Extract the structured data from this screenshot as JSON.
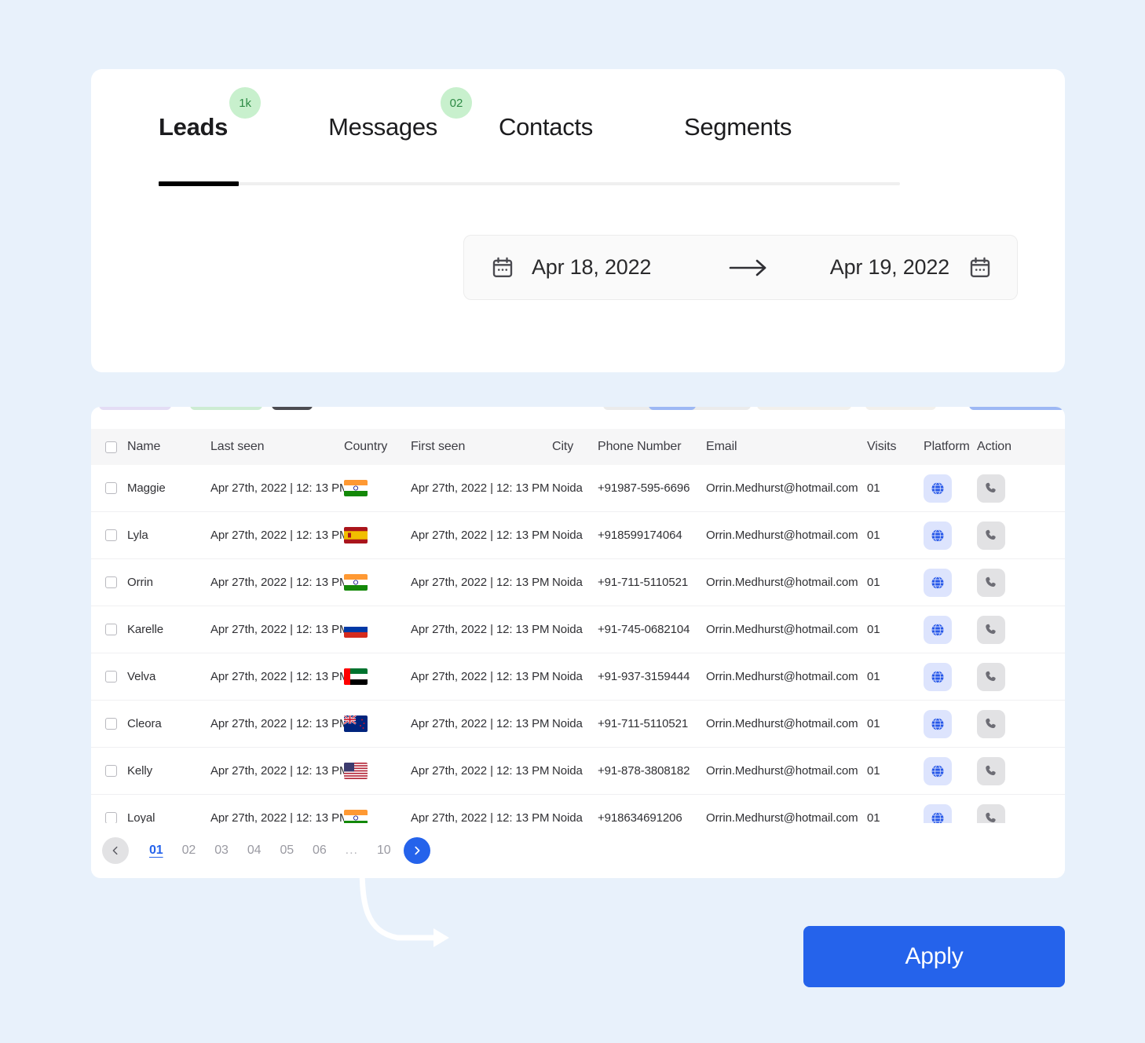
{
  "tabs": [
    {
      "label": "Leads",
      "badge": "1k",
      "active": true
    },
    {
      "label": "Messages",
      "badge": "02",
      "active": false
    },
    {
      "label": "Contacts",
      "badge": "",
      "active": false
    },
    {
      "label": "Segments",
      "badge": "",
      "active": false
    }
  ],
  "date_range": {
    "start": "Apr 18, 2022",
    "end": "Apr 19, 2022",
    "start_icon": "calendar-icon",
    "end_icon": "calendar-icon",
    "separator_icon": "arrow-right-icon"
  },
  "table": {
    "columns": [
      "Name",
      "Last seen",
      "Country",
      "First seen",
      "City",
      "Phone Number",
      "Email",
      "Visits",
      "Platform",
      "Action"
    ],
    "platform_icon": "globe-icon",
    "action_icon": "phone-icon",
    "rows": [
      {
        "name": "Maggie",
        "last_seen": "Apr 27th, 2022 | 12: 13 PM",
        "country": "in",
        "country_label": "India",
        "first_seen": "Apr 27th, 2022 | 12: 13 PM",
        "city": "Noida",
        "phone": "+91987-595-6696",
        "email": "Orrin.Medhurst@hotmail.com",
        "visits": "01"
      },
      {
        "name": "Lyla",
        "last_seen": "Apr 27th, 2022 | 12: 13 PM",
        "country": "es",
        "country_label": "Spain",
        "first_seen": "Apr 27th, 2022 | 12: 13 PM",
        "city": "Noida",
        "phone": "+918599174064",
        "email": "Orrin.Medhurst@hotmail.com",
        "visits": "01"
      },
      {
        "name": "Orrin",
        "last_seen": "Apr 27th, 2022 | 12: 13 PM",
        "country": "in",
        "country_label": "India",
        "first_seen": "Apr 27th, 2022 | 12: 13 PM",
        "city": "Noida",
        "phone": "+91-711-5110521",
        "email": "Orrin.Medhurst@hotmail.com",
        "visits": "01"
      },
      {
        "name": "Karelle",
        "last_seen": "Apr 27th, 2022 | 12: 13 PM",
        "country": "ru",
        "country_label": "Russia",
        "first_seen": "Apr 27th, 2022 | 12: 13 PM",
        "city": "Noida",
        "phone": "+91-745-0682104",
        "email": "Orrin.Medhurst@hotmail.com",
        "visits": "01"
      },
      {
        "name": "Velva",
        "last_seen": "Apr 27th, 2022 | 12: 13 PM",
        "country": "ae",
        "country_label": "UAE",
        "first_seen": "Apr 27th, 2022 | 12: 13 PM",
        "city": "Noida",
        "phone": "+91-937-3159444",
        "email": "Orrin.Medhurst@hotmail.com",
        "visits": "01"
      },
      {
        "name": "Cleora",
        "last_seen": "Apr 27th, 2022 | 12: 13 PM",
        "country": "nz",
        "country_label": "New Zealand",
        "first_seen": "Apr 27th, 2022 | 12: 13 PM",
        "city": "Noida",
        "phone": "+91-711-5110521",
        "email": "Orrin.Medhurst@hotmail.com",
        "visits": "01"
      },
      {
        "name": "Kelly",
        "last_seen": "Apr 27th, 2022 | 12: 13 PM",
        "country": "us",
        "country_label": "USA",
        "first_seen": "Apr 27th, 2022 | 12: 13 PM",
        "city": "Noida",
        "phone": "+91-878-3808182",
        "email": "Orrin.Medhurst@hotmail.com",
        "visits": "01"
      },
      {
        "name": "Loyal",
        "last_seen": "Apr 27th, 2022 | 12: 13 PM",
        "country": "in",
        "country_label": "India",
        "first_seen": "Apr 27th, 2022 | 12: 13 PM",
        "city": "Noida",
        "phone": "+918634691206",
        "email": "Orrin.Medhurst@hotmail.com",
        "visits": "01"
      }
    ]
  },
  "pagination": {
    "prev_icon": "chevron-left-icon",
    "next_icon": "chevron-right-icon",
    "pages": [
      "01",
      "02",
      "03",
      "04",
      "05",
      "06",
      "...",
      "10"
    ],
    "current": "01"
  },
  "apply": {
    "label": "Apply"
  },
  "colors": {
    "background": "#e8f1fb",
    "card": "#ffffff",
    "accent_blue": "#2563eb",
    "badge_green_bg": "#c8f0cd",
    "badge_green_text": "#2e8b45",
    "platform_chip_bg": "#dde4fd",
    "action_chip_bg": "#e2e2e4",
    "header_row_bg": "#f6f6f7"
  }
}
